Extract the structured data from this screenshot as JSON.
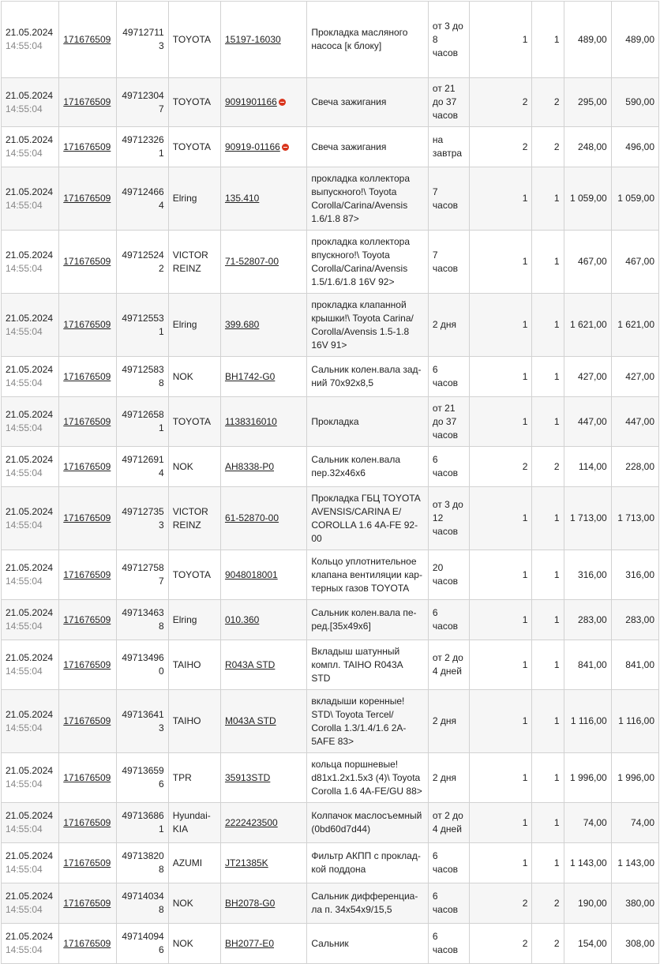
{
  "orders": [
    {
      "date": "21.05.2024",
      "time": "14:55:04",
      "order": "171676509",
      "pos": "497127113",
      "brand": "TOYOTA",
      "article": "15197-16030",
      "no_stock": false,
      "desc": "Прокладка масляного насоса [к блоку]",
      "term": "от 3 до 8 часов",
      "q1": "1",
      "q2": "1",
      "price": "489,00",
      "sum": "489,00"
    },
    {
      "date": "21.05.2024",
      "time": "14:55:04",
      "order": "171676509",
      "pos": "497123047",
      "brand": "TOYOTA",
      "article": "9091901166",
      "no_stock": true,
      "desc": "Свеча зажигания",
      "term": "от 21 до 37 часов",
      "q1": "2",
      "q2": "2",
      "price": "295,00",
      "sum": "590,00"
    },
    {
      "date": "21.05.2024",
      "time": "14:55:04",
      "order": "171676509",
      "pos": "497123261",
      "brand": "TOYOTA",
      "article": "90919-01166",
      "no_stock": true,
      "desc": "Свеча зажигания",
      "term": "на завтра",
      "q1": "2",
      "q2": "2",
      "price": "248,00",
      "sum": "496,00"
    },
    {
      "date": "21.05.2024",
      "time": "14:55:04",
      "order": "171676509",
      "pos": "497124664",
      "brand": "Elring",
      "article": "135.410",
      "no_stock": false,
      "desc": "прокладка коллектора выпускного!\\ Toyota Corolla/Carina/Avensis 1.6/1.8 87>",
      "term": "7 часов",
      "q1": "1",
      "q2": "1",
      "price": "1 059,00",
      "sum": "1 059,00"
    },
    {
      "date": "21.05.2024",
      "time": "14:55:04",
      "order": "171676509",
      "pos": "497125242",
      "brand": "VICTOR REINZ",
      "article": "71-52807-00",
      "no_stock": false,
      "desc": "прокладка коллектора впускного!\\ Toyota Corolla/Carina/Avensis 1.5/1.6/1.8 16V 92>",
      "term": "7 часов",
      "q1": "1",
      "q2": "1",
      "price": "467,00",
      "sum": "467,00"
    },
    {
      "date": "21.05.2024",
      "time": "14:55:04",
      "order": "171676509",
      "pos": "497125531",
      "brand": "Elring",
      "article": "399.680",
      "no_stock": false,
      "desc": "прокладка клапанной крышки!\\ Toyota Carina/ Corolla/Avensis 1.5-1.8 16V 91>",
      "term": "2 дня",
      "q1": "1",
      "q2": "1",
      "price": "1 621,00",
      "sum": "1 621,00"
    },
    {
      "date": "21.05.2024",
      "time": "14:55:04",
      "order": "171676509",
      "pos": "497125838",
      "brand": "NOK",
      "article": "BH1742-G0",
      "no_stock": false,
      "desc": "Сальник колен.вала зад­ний 70x92x8,5",
      "term": "6 часов",
      "q1": "1",
      "q2": "1",
      "price": "427,00",
      "sum": "427,00"
    },
    {
      "date": "21.05.2024",
      "time": "14:55:04",
      "order": "171676509",
      "pos": "497126581",
      "brand": "TOYOTA",
      "article": "1138316010",
      "no_stock": false,
      "desc": "Прокладка",
      "term": "от 21 до 37 часов",
      "q1": "1",
      "q2": "1",
      "price": "447,00",
      "sum": "447,00"
    },
    {
      "date": "21.05.2024",
      "time": "14:55:04",
      "order": "171676509",
      "pos": "497126914",
      "brand": "NOK",
      "article": "AH8338-P0",
      "no_stock": false,
      "desc": "Сальник колен.вала пер.32x46x6",
      "term": "6 часов",
      "q1": "2",
      "q2": "2",
      "price": "114,00",
      "sum": "228,00"
    },
    {
      "date": "21.05.2024",
      "time": "14:55:04",
      "order": "171676509",
      "pos": "497127353",
      "brand": "VICTOR REINZ",
      "article": "61-52870-00",
      "no_stock": false,
      "desc": "Прокладка ГБЦ TOYOTA AVENSIS/CARINA E/ COROLLA 1.6 4A-FE 92-00",
      "term": "от 3 до 12 часов",
      "q1": "1",
      "q2": "1",
      "price": "1 713,00",
      "sum": "1 713,00"
    },
    {
      "date": "21.05.2024",
      "time": "14:55:04",
      "order": "171676509",
      "pos": "497127587",
      "brand": "TOYOTA",
      "article": "9048018001",
      "no_stock": false,
      "desc": "Кольцо уплотнительное клапана вентиляции кар­терных газов TOYOTA",
      "term": "20 часов",
      "q1": "1",
      "q2": "1",
      "price": "316,00",
      "sum": "316,00"
    },
    {
      "date": "21.05.2024",
      "time": "14:55:04",
      "order": "171676509",
      "pos": "497134638",
      "brand": "Elring",
      "article": "010.360",
      "no_stock": false,
      "desc": "Сальник колен.вала пе­ред.[35x49x6]",
      "term": "6 часов",
      "q1": "1",
      "q2": "1",
      "price": "283,00",
      "sum": "283,00"
    },
    {
      "date": "21.05.2024",
      "time": "14:55:04",
      "order": "171676509",
      "pos": "497134960",
      "brand": "TAIHO",
      "article": "R043A STD",
      "no_stock": false,
      "desc": "Вкладыш шатунный компл. TAIHO R043A STD",
      "term": "от 2 до 4 дней",
      "q1": "1",
      "q2": "1",
      "price": "841,00",
      "sum": "841,00"
    },
    {
      "date": "21.05.2024",
      "time": "14:55:04",
      "order": "171676509",
      "pos": "497136413",
      "brand": "TAIHO",
      "article": "M043A STD",
      "no_stock": false,
      "desc": "вкладыши коренные! STD\\ Toyota Tercel/ Corolla 1.3/1.4/1.6 2A-5AFE 83>",
      "term": "2 дня",
      "q1": "1",
      "q2": "1",
      "price": "1 116,00",
      "sum": "1 116,00"
    },
    {
      "date": "21.05.2024",
      "time": "14:55:04",
      "order": "171676509",
      "pos": "497136596",
      "brand": "TPR",
      "article": "35913STD",
      "no_stock": false,
      "desc": "кольца поршневые! d81x1.2x1.5x3 (4)\\ Toyota Corolla 1.6 4A-FE/GU 88>",
      "term": "2 дня",
      "q1": "1",
      "q2": "1",
      "price": "1 996,00",
      "sum": "1 996,00"
    },
    {
      "date": "21.05.2024",
      "time": "14:55:04",
      "order": "171676509",
      "pos": "497136861",
      "brand": "Hyundai-KIA",
      "article": "2222423500",
      "no_stock": false,
      "desc": "Колпачок маслосъемный (0bd60d7d44)",
      "term": "от 2 до 4 дней",
      "q1": "1",
      "q2": "1",
      "price": "74,00",
      "sum": "74,00"
    },
    {
      "date": "21.05.2024",
      "time": "14:55:04",
      "order": "171676509",
      "pos": "497138208",
      "brand": "AZUMI",
      "article": "JT21385K",
      "no_stock": false,
      "desc": "Фильтр АКПП с проклад­кой поддона",
      "term": "6 часов",
      "q1": "1",
      "q2": "1",
      "price": "1 143,00",
      "sum": "1 143,00"
    },
    {
      "date": "21.05.2024",
      "time": "14:55:04",
      "order": "171676509",
      "pos": "497140348",
      "brand": "NOK",
      "article": "BH2078-G0",
      "no_stock": false,
      "desc": "Сальник дифференциа­ла п. 34x54x9/15,5",
      "term": "6 часов",
      "q1": "2",
      "q2": "2",
      "price": "190,00",
      "sum": "380,00"
    },
    {
      "date": "21.05.2024",
      "time": "14:55:04",
      "order": "171676509",
      "pos": "497140946",
      "brand": "NOK",
      "article": "BH2077-E0",
      "no_stock": false,
      "desc": "Сальник",
      "term": "6 часов",
      "q1": "2",
      "q2": "2",
      "price": "154,00",
      "sum": "308,00"
    }
  ],
  "icons": {
    "no_stock": "no-entry-icon",
    "no_stock_color": "#d9341c"
  }
}
